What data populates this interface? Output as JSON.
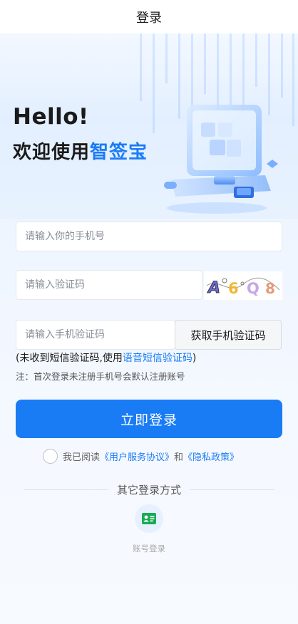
{
  "header": {
    "title": "登录"
  },
  "hero": {
    "greeting": "Hello!",
    "welcome_prefix": "欢迎使用",
    "brand_name": "智签宝"
  },
  "form": {
    "phone_placeholder": "请输入你的手机号",
    "captcha_placeholder": "请输入验证码",
    "captcha_text": "A6Q8",
    "sms_placeholder": "请输入手机验证码",
    "sms_button_label": "获取手机验证码",
    "voice_prefix": "(未收到短信验证码,使用",
    "voice_link": "语音短信验证码",
    "voice_suffix": ")",
    "note": "注：首次登录未注册手机号会默认注册账号",
    "login_button_label": "立即登录"
  },
  "agreement": {
    "prefix": "我已阅读",
    "user_agreement": "《用户服务协议》",
    "and": "和",
    "privacy_policy": "《隐私政策》"
  },
  "other_login": {
    "title": "其它登录方式",
    "account_login_label": "账号登录",
    "icon": "id-card-icon"
  },
  "colors": {
    "accent": "#1a7cf5",
    "icon_green": "#1aaa55"
  }
}
